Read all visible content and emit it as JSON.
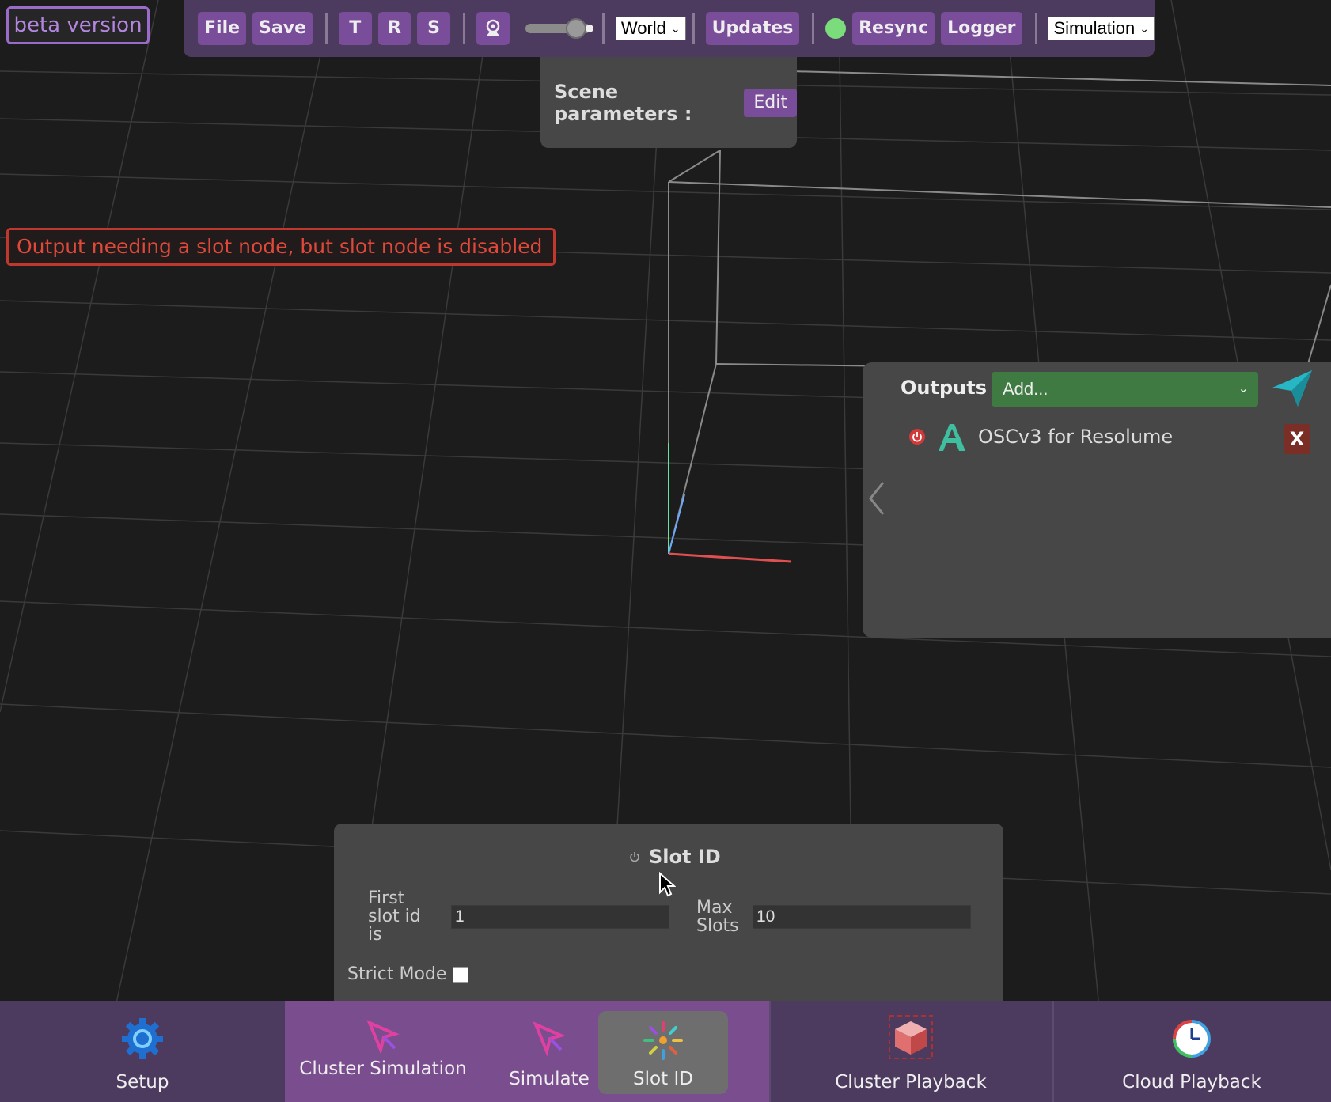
{
  "badge": {
    "label": "beta version"
  },
  "toolbar": {
    "file": "File",
    "save": "Save",
    "t": "T",
    "r": "R",
    "s": "S",
    "space_select": "World",
    "updates": "Updates",
    "resync": "Resync",
    "logger": "Logger",
    "mode_select": "Simulation",
    "status_color": "#7bdc7b"
  },
  "scene": {
    "label": "Scene parameters :",
    "edit": "Edit"
  },
  "error": {
    "message": "Output needing a slot node, but slot node is disabled"
  },
  "outputs": {
    "title": "Outputs",
    "add_select": "Add...",
    "items": [
      {
        "label": "OSCv3 for Resolume",
        "remove": "X"
      }
    ]
  },
  "slot_panel": {
    "title": "Slot ID",
    "first_label": "First slot id is",
    "first_value": "1",
    "max_label": "Max Slots",
    "max_value": "10",
    "strict_label": "Strict Mode"
  },
  "bottom_tabs": {
    "setup": "Setup",
    "cluster_simulation": "Cluster Simulation",
    "simulate": "Simulate",
    "slot_id": "Slot ID",
    "cluster_playback": "Cluster Playback",
    "cloud_playback": "Cloud Playback"
  },
  "colors": {
    "accent": "#7a4d9a",
    "bar": "#4d3a5f",
    "error": "#e0483a",
    "add_green": "#3e7a41"
  }
}
